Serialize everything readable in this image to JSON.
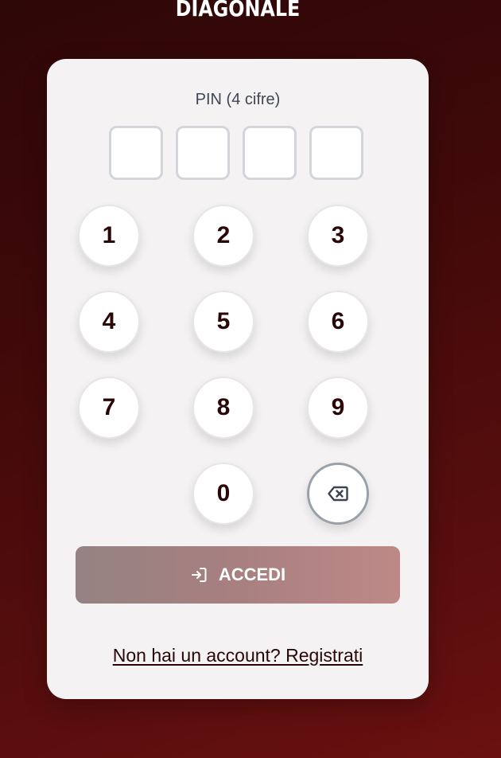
{
  "brand": {
    "title": "DIAGONALE"
  },
  "pin": {
    "label": "PIN (4 cifre)",
    "digits": [
      "",
      "",
      "",
      ""
    ]
  },
  "keypad": {
    "keys": [
      "1",
      "2",
      "3",
      "4",
      "5",
      "6",
      "7",
      "8",
      "9",
      "0"
    ],
    "backspace_icon": "backspace-icon"
  },
  "actions": {
    "submit_label": "ACCEDI",
    "submit_icon": "login-icon",
    "register_link": "Non hai un account? Registrati"
  },
  "colors": {
    "background": "#4a0b0b",
    "card": "#f4f2f2",
    "key_text": "#2a0606",
    "submit_gradient_start": "#958282",
    "submit_gradient_end": "#bd8987"
  }
}
